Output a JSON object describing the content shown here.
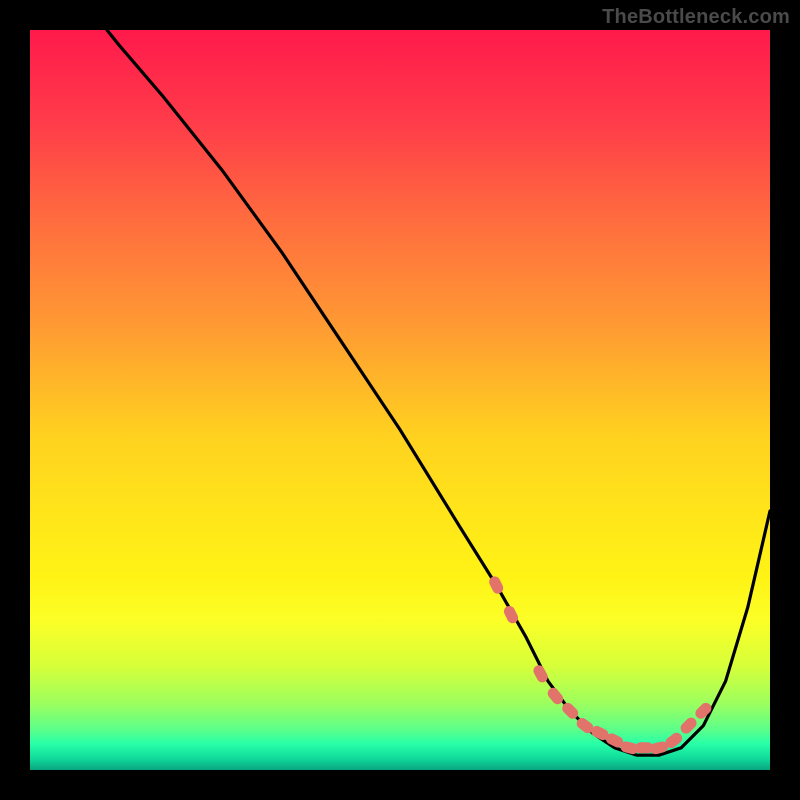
{
  "attribution": "TheBottleneck.com",
  "gradient": {
    "stops": [
      {
        "offset": 0.0,
        "color": "#ff1a4b"
      },
      {
        "offset": 0.12,
        "color": "#ff3a4a"
      },
      {
        "offset": 0.25,
        "color": "#ff6a3f"
      },
      {
        "offset": 0.4,
        "color": "#ff9a33"
      },
      {
        "offset": 0.55,
        "color": "#ffd21f"
      },
      {
        "offset": 0.66,
        "color": "#ffe61a"
      },
      {
        "offset": 0.74,
        "color": "#fff315"
      },
      {
        "offset": 0.8,
        "color": "#fbff27"
      },
      {
        "offset": 0.86,
        "color": "#d6ff3a"
      },
      {
        "offset": 0.91,
        "color": "#9cff5e"
      },
      {
        "offset": 0.945,
        "color": "#5cff8a"
      },
      {
        "offset": 0.965,
        "color": "#27ffa8"
      },
      {
        "offset": 0.985,
        "color": "#10d99a"
      },
      {
        "offset": 1.0,
        "color": "#0aa57f"
      }
    ]
  },
  "chart_data": {
    "type": "line",
    "title": "",
    "xlabel": "",
    "ylabel": "",
    "xlim": [
      0,
      100
    ],
    "ylim": [
      0,
      100
    ],
    "series": [
      {
        "name": "bottleneck-curve",
        "x": [
          0,
          4,
          8,
          12,
          18,
          26,
          34,
          42,
          50,
          58,
          63,
          67,
          70,
          73,
          76,
          79,
          82,
          85,
          88,
          91,
          94,
          97,
          100
        ],
        "y": [
          113,
          108,
          103,
          98,
          91,
          81,
          70,
          58,
          46,
          33,
          25,
          18,
          12,
          8,
          5,
          3,
          2,
          2,
          3,
          6,
          12,
          22,
          35
        ]
      }
    ],
    "markers": {
      "name": "trough-points",
      "color": "#e2736b",
      "x": [
        63,
        65,
        69,
        71,
        73,
        75,
        77,
        79,
        81,
        83,
        85,
        87,
        89,
        91
      ],
      "y": [
        25,
        21,
        13,
        10,
        8,
        6,
        5,
        4,
        3,
        3,
        3,
        4,
        6,
        8
      ]
    }
  }
}
